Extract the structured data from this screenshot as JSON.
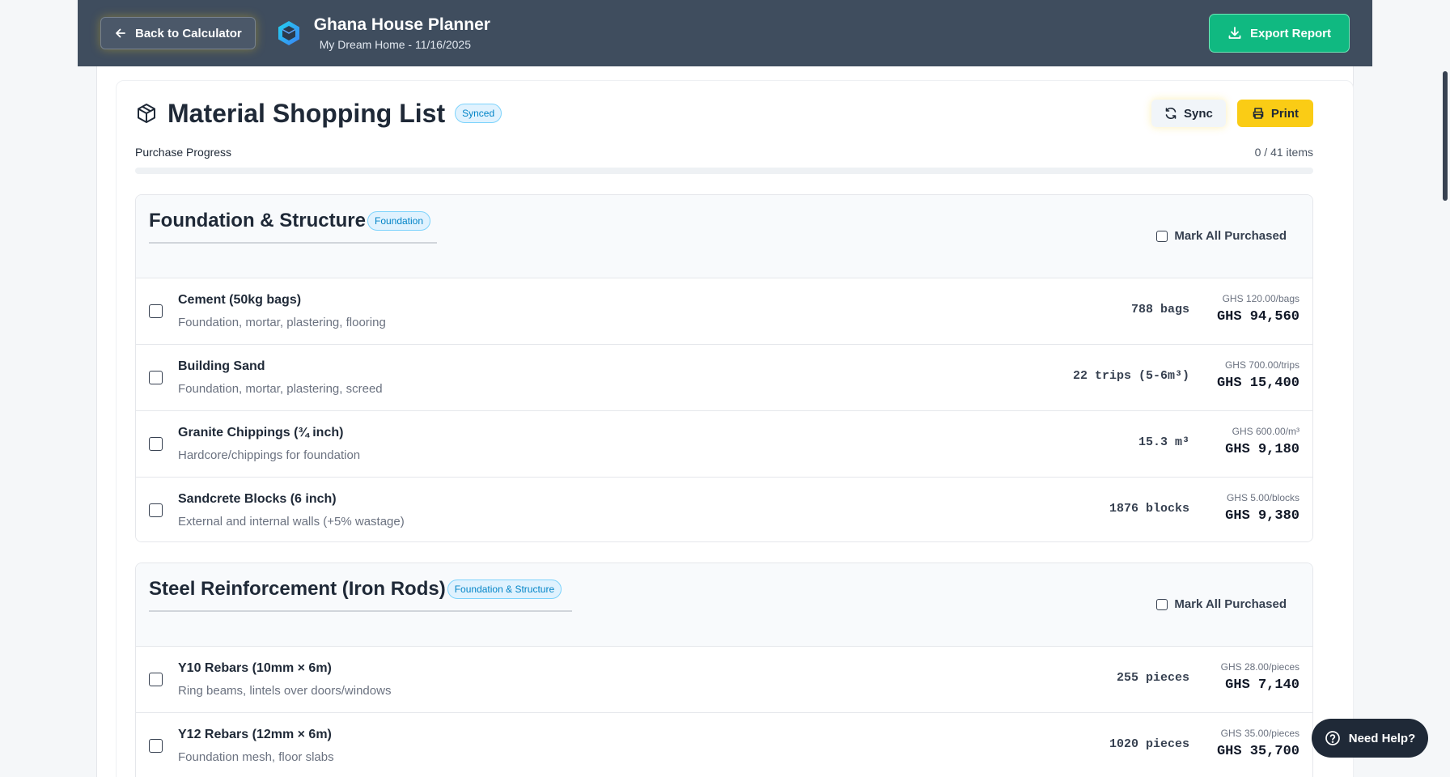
{
  "header": {
    "back_label": "Back to Calculator",
    "app_title": "Ghana House Planner",
    "subtitle": "My Dream Home - 11/16/2025",
    "export_label": "Export Report"
  },
  "list": {
    "title": "Material Shopping List",
    "status_badge": "Synced",
    "sync_label": "Sync",
    "print_label": "Print",
    "progress_label": "Purchase Progress",
    "progress_count": "0 / 41 items",
    "progress_fraction": 0
  },
  "sections": [
    {
      "title": "Foundation & Structure",
      "badge": "Foundation",
      "mark_all_label": "Mark All Purchased",
      "items": [
        {
          "name": "Cement (50kg bags)",
          "desc": "Foundation, mortar, plastering, flooring",
          "qty": "788 bags",
          "unit_price": "GHS 120.00/bags",
          "total": "GHS 94,560"
        },
        {
          "name": "Building Sand",
          "desc": "Foundation, mortar, plastering, screed",
          "qty": "22 trips (5-6m³)",
          "unit_price": "GHS 700.00/trips",
          "total": "GHS 15,400"
        },
        {
          "name": "Granite Chippings (¾ inch)",
          "desc": "Hardcore/chippings for foundation",
          "qty": "15.3 m³",
          "unit_price": "GHS 600.00/m³",
          "total": "GHS 9,180"
        },
        {
          "name": "Sandcrete Blocks (6 inch)",
          "desc": "External and internal walls (+5% wastage)",
          "qty": "1876 blocks",
          "unit_price": "GHS 5.00/blocks",
          "total": "GHS 9,380"
        }
      ]
    },
    {
      "title": "Steel Reinforcement (Iron Rods)",
      "badge": "Foundation & Structure",
      "mark_all_label": "Mark All Purchased",
      "items": [
        {
          "name": "Y10 Rebars (10mm × 6m)",
          "desc": "Ring beams, lintels over doors/windows",
          "qty": "255 pieces",
          "unit_price": "GHS 28.00/pieces",
          "total": "GHS 7,140"
        },
        {
          "name": "Y12 Rebars (12mm × 6m)",
          "desc": "Foundation mesh, floor slabs",
          "qty": "1020 pieces",
          "unit_price": "GHS 35.00/pieces",
          "total": "GHS 35,700"
        }
      ]
    }
  ],
  "help": {
    "label": "Need Help?"
  },
  "icons": {
    "back": "arrow-left-icon",
    "logo": "hexagon-logo-icon",
    "export": "download-icon",
    "list": "package-box-icon",
    "sync": "refresh-icon",
    "print": "printer-icon",
    "help": "question-circle-icon"
  },
  "colors": {
    "header_bg": "#3f4d5e",
    "export_green": "#10b981",
    "print_yellow": "#facc15",
    "badge_blue": "#0284c7"
  }
}
